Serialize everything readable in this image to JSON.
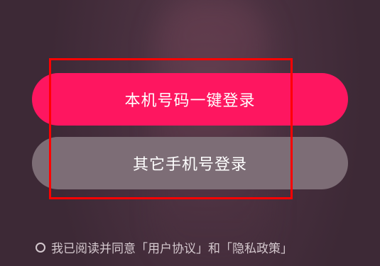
{
  "buttons": {
    "one_click_login": "本机号码一键登录",
    "other_phone_login": "其它手机号登录"
  },
  "agreement": {
    "text": "我已阅读并同意「用户协议」和「隐私政策」"
  },
  "colors": {
    "primary_button": "#fe1660",
    "secondary_button": "#7d6d76",
    "highlight_box": "#ff0000",
    "background": "#3d2936"
  },
  "icons": {
    "agreement_checkbox": "radio-circle-icon"
  }
}
